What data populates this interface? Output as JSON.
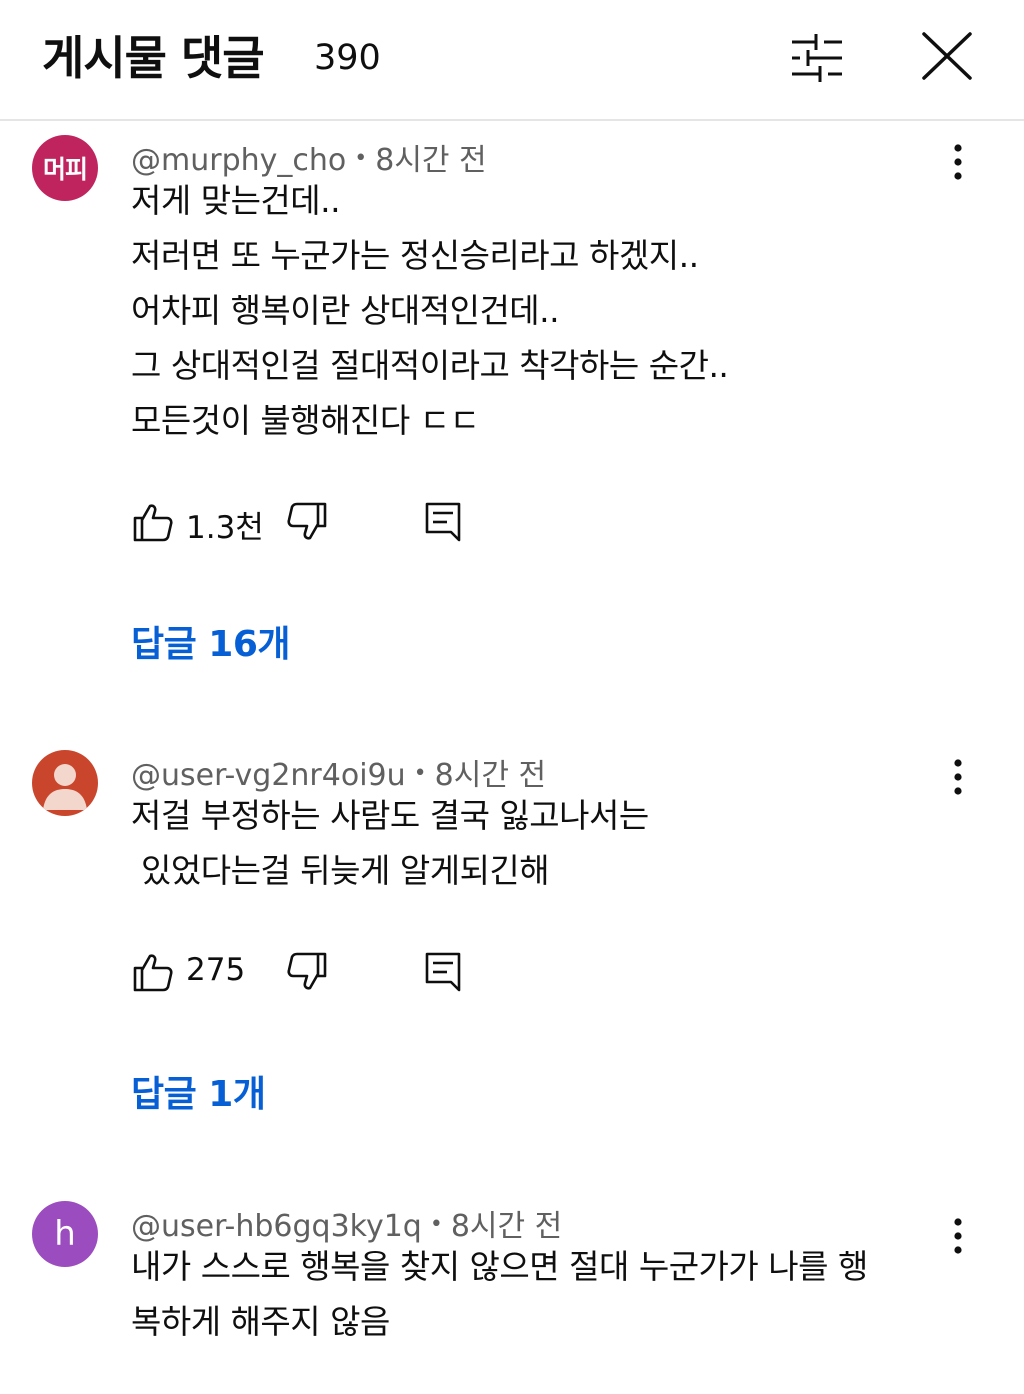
{
  "header": {
    "title": "게시물 댓글",
    "count": "390"
  },
  "icons": {
    "filter": "sliders-icon",
    "close": "close-icon",
    "more": "more-vertical-icon",
    "like": "thumbs-up-icon",
    "dislike": "thumbs-down-icon",
    "reply": "comment-reply-icon"
  },
  "colors": {
    "link": "#065fd4",
    "meta": "#606060",
    "avatar1": "#c0245e",
    "avatar2": "#c9462c",
    "avatar3": "#9b4dbf"
  },
  "comments": [
    {
      "avatar_text": "머피",
      "handle": "@murphy_cho",
      "separator": "•",
      "time": "8시간 전",
      "body": "저게 맞는건데..\n저러면 또 누군가는 정신승리라고 하겠지..\n어차피 행복이란 상대적인건데..\n그 상대적인걸 절대적이라고 착각하는 순간..\n모든것이 불행해진다 ㄷㄷ",
      "likes": "1.3천",
      "replies_label": "답글 16개"
    },
    {
      "handle": "@user-vg2nr4oi9u",
      "separator": "•",
      "time": "8시간 전",
      "body": "저걸 부정하는 사람도 결국 잃고나서는\n 있었다는걸 뒤늦게 알게되긴해",
      "likes": "275",
      "replies_label": "답글 1개"
    },
    {
      "avatar_text": "h",
      "handle": "@user-hb6gq3ky1q",
      "separator": "•",
      "time": "8시간 전",
      "body": "내가 스스로 행복을 찾지 않으면 절대 누군가가 나를 행\n복하게 해주지 않음"
    }
  ]
}
